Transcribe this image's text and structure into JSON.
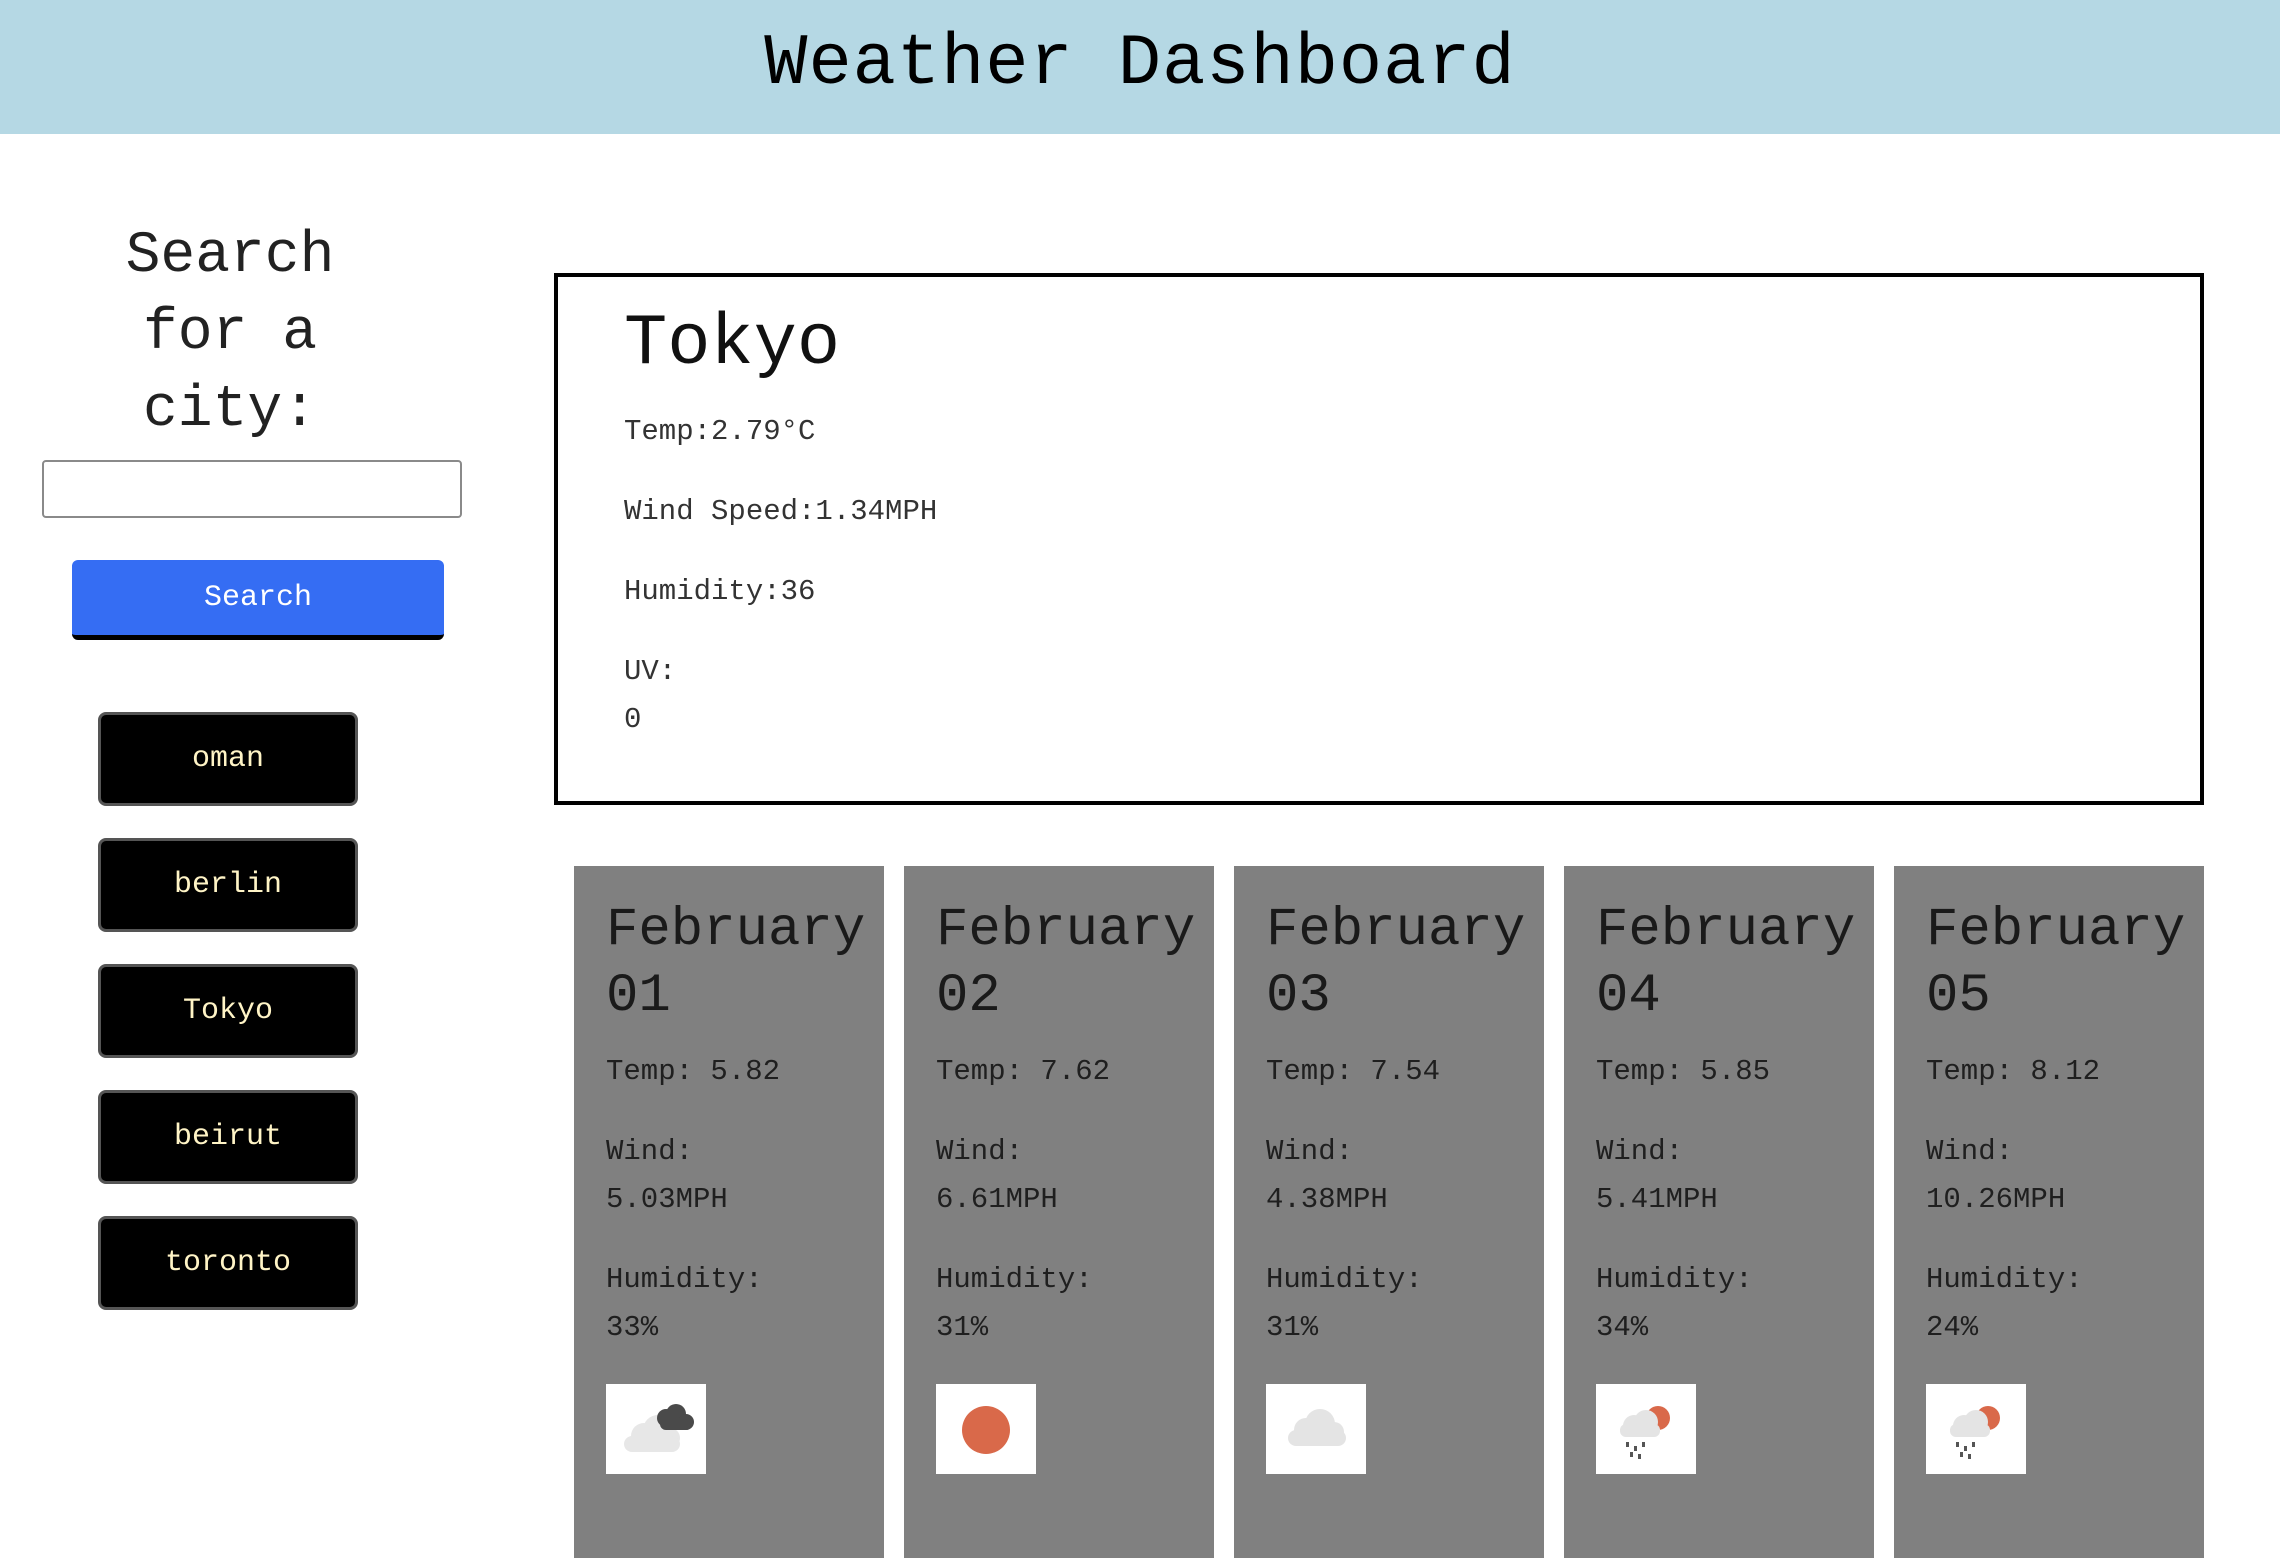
{
  "header": {
    "title": "Weather Dashboard"
  },
  "sidebar": {
    "search_heading": "Search for a city:",
    "search_input_value": "",
    "search_button_label": "Search",
    "history": [
      "oman",
      "berlin",
      "Tokyo",
      "beirut",
      "toronto"
    ]
  },
  "current": {
    "city": "Tokyo",
    "temp": "Temp:2.79°C",
    "wind": "Wind Speed:1.34MPH",
    "humidity": "Humidity:36",
    "uv_label": "UV:",
    "uv_value": "0"
  },
  "forecast": [
    {
      "date_month": "February",
      "date_day": "01",
      "temp_label": "Temp: 5.82",
      "wind_label": "Wind:",
      "wind_value": "5.03MPH",
      "humidity_label": "Humidity:",
      "humidity_value": "33%",
      "icon": "broken-clouds-icon"
    },
    {
      "date_month": "February",
      "date_day": "02",
      "temp_label": "Temp: 7.62",
      "wind_label": "Wind:",
      "wind_value": "6.61MPH",
      "humidity_label": "Humidity:",
      "humidity_value": "31%",
      "icon": "clear-sky-sun-icon"
    },
    {
      "date_month": "February",
      "date_day": "03",
      "temp_label": "Temp: 7.54",
      "wind_label": "Wind:",
      "wind_value": "4.38MPH",
      "humidity_label": "Humidity:",
      "humidity_value": "31%",
      "icon": "cloud-icon"
    },
    {
      "date_month": "February",
      "date_day": "04",
      "temp_label": "Temp: 5.85",
      "wind_label": "Wind:",
      "wind_value": "5.41MPH",
      "humidity_label": "Humidity:",
      "humidity_value": "34%",
      "icon": "rain-sun-icon"
    },
    {
      "date_month": "February",
      "date_day": "05",
      "temp_label": "Temp: 8.12",
      "wind_label": "Wind:",
      "wind_value": "10.26MPH",
      "humidity_label": "Humidity:",
      "humidity_value": "24%",
      "icon": "rain-sun-icon"
    }
  ],
  "colors": {
    "header_bg": "#b5d8e4",
    "search_button_bg": "#356df3",
    "forecast_card_bg": "#808080",
    "history_button_bg": "#000000",
    "history_button_text": "#fff4c6",
    "sun": "#d9694a"
  }
}
